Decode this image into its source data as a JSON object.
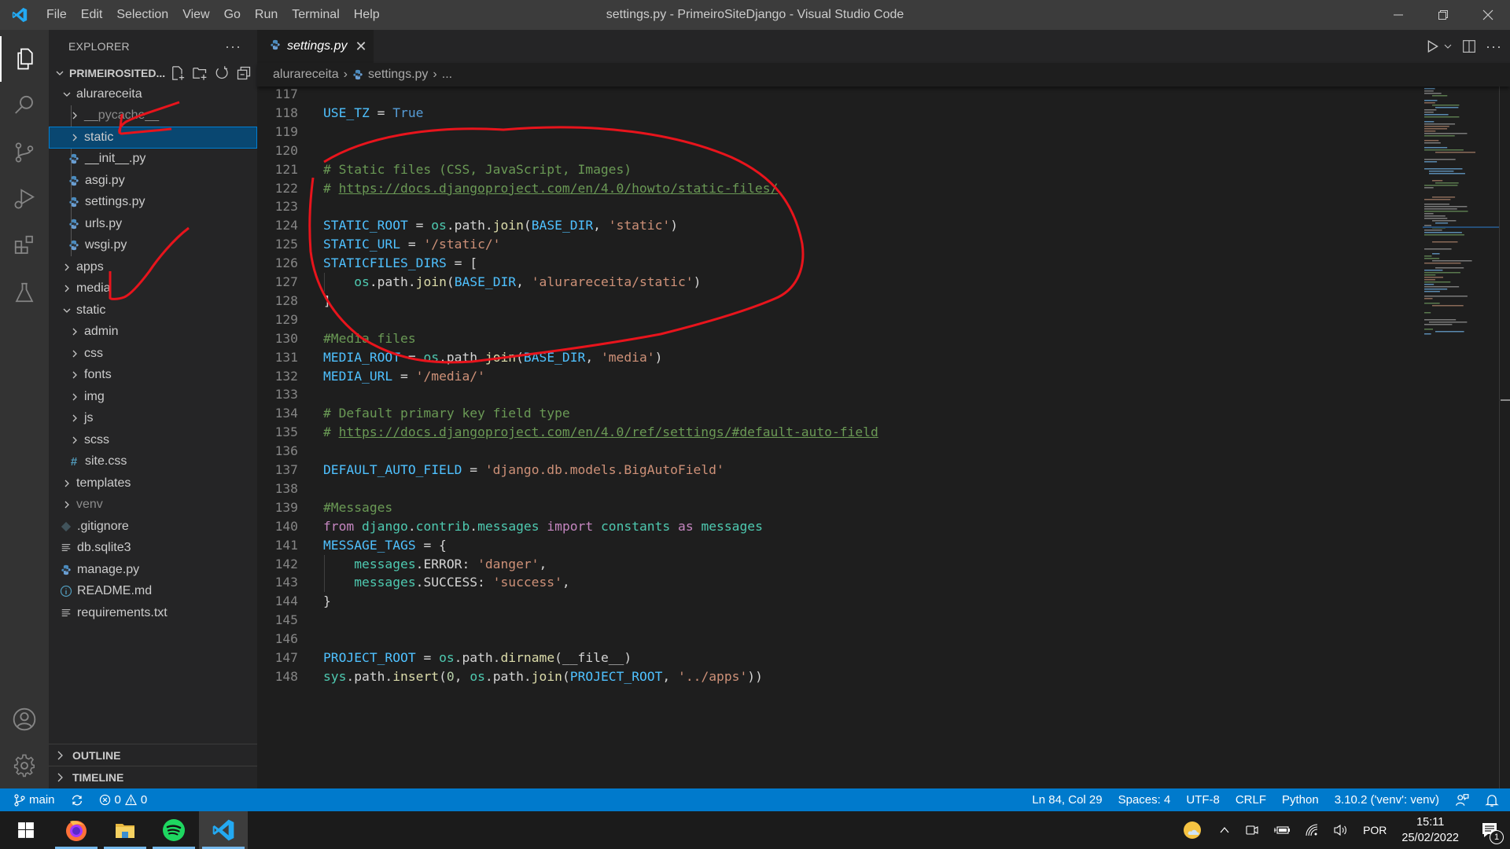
{
  "window": {
    "title": "settings.py - PrimeiroSiteDjango - Visual Studio Code",
    "menu": [
      "File",
      "Edit",
      "Selection",
      "View",
      "Go",
      "Run",
      "Terminal",
      "Help"
    ]
  },
  "sidebar": {
    "header": "EXPLORER",
    "project": "PRIMEIROSITED...",
    "tree": [
      {
        "label": "alurareceita",
        "type": "folder",
        "expanded": true,
        "depth": 1
      },
      {
        "label": "__pycache__",
        "type": "folder",
        "expanded": false,
        "depth": 2,
        "dim": true
      },
      {
        "label": "static",
        "type": "folder",
        "expanded": false,
        "depth": 2,
        "selected": true
      },
      {
        "label": "__init__.py",
        "type": "python",
        "depth": 2
      },
      {
        "label": "asgi.py",
        "type": "python",
        "depth": 2
      },
      {
        "label": "settings.py",
        "type": "python",
        "depth": 2
      },
      {
        "label": "urls.py",
        "type": "python",
        "depth": 2
      },
      {
        "label": "wsgi.py",
        "type": "python",
        "depth": 2
      },
      {
        "label": "apps",
        "type": "folder",
        "expanded": false,
        "depth": 1
      },
      {
        "label": "media",
        "type": "folder",
        "expanded": false,
        "depth": 1
      },
      {
        "label": "static",
        "type": "folder",
        "expanded": true,
        "depth": 1
      },
      {
        "label": "admin",
        "type": "folder",
        "expanded": false,
        "depth": 2
      },
      {
        "label": "css",
        "type": "folder",
        "expanded": false,
        "depth": 2
      },
      {
        "label": "fonts",
        "type": "folder",
        "expanded": false,
        "depth": 2
      },
      {
        "label": "img",
        "type": "folder",
        "expanded": false,
        "depth": 2
      },
      {
        "label": "js",
        "type": "folder",
        "expanded": false,
        "depth": 2
      },
      {
        "label": "scss",
        "type": "folder",
        "expanded": false,
        "depth": 2
      },
      {
        "label": "site.css",
        "type": "css",
        "depth": 2
      },
      {
        "label": "templates",
        "type": "folder",
        "expanded": false,
        "depth": 1
      },
      {
        "label": "venv",
        "type": "folder",
        "expanded": false,
        "depth": 1,
        "dim": true
      },
      {
        "label": ".gitignore",
        "type": "git",
        "depth": 1
      },
      {
        "label": "db.sqlite3",
        "type": "text",
        "depth": 1
      },
      {
        "label": "manage.py",
        "type": "python",
        "depth": 1
      },
      {
        "label": "README.md",
        "type": "info",
        "depth": 1
      },
      {
        "label": "requirements.txt",
        "type": "text",
        "depth": 1
      }
    ],
    "sections": [
      "OUTLINE",
      "TIMELINE"
    ]
  },
  "editor": {
    "tab": {
      "label": "settings.py",
      "icon": "python-icon"
    },
    "breadcrumb": [
      "alurareceita",
      "settings.py",
      "..."
    ],
    "lines": [
      {
        "n": "117",
        "tokens": []
      },
      {
        "n": "118",
        "tokens": [
          [
            "var",
            "USE_TZ"
          ],
          [
            "plain",
            " = "
          ],
          [
            "const",
            "True"
          ]
        ]
      },
      {
        "n": "119",
        "tokens": []
      },
      {
        "n": "120",
        "tokens": []
      },
      {
        "n": "121",
        "tokens": [
          [
            "com",
            "# Static files (CSS, JavaScript, Images)"
          ]
        ]
      },
      {
        "n": "122",
        "tokens": [
          [
            "com",
            "# "
          ],
          [
            "link",
            "https://docs.djangoproject.com/en/4.0/howto/static-files/"
          ]
        ]
      },
      {
        "n": "123",
        "tokens": []
      },
      {
        "n": "124",
        "tokens": [
          [
            "var",
            "STATIC_ROOT"
          ],
          [
            "plain",
            " = "
          ],
          [
            "mod",
            "os"
          ],
          [
            "plain",
            "."
          ],
          [
            "plain",
            "path"
          ],
          [
            "plain",
            "."
          ],
          [
            "fn",
            "join"
          ],
          [
            "plain",
            "("
          ],
          [
            "var",
            "BASE_DIR"
          ],
          [
            "plain",
            ", "
          ],
          [
            "str",
            "'static'"
          ],
          [
            "plain",
            ")"
          ]
        ]
      },
      {
        "n": "125",
        "tokens": [
          [
            "var",
            "STATIC_URL"
          ],
          [
            "plain",
            " = "
          ],
          [
            "str",
            "'/static/'"
          ]
        ]
      },
      {
        "n": "126",
        "tokens": [
          [
            "var",
            "STATICFILES_DIRS"
          ],
          [
            "plain",
            " = ["
          ]
        ]
      },
      {
        "n": "127",
        "tokens": [
          [
            "plain",
            "    "
          ],
          [
            "mod",
            "os"
          ],
          [
            "plain",
            ".path."
          ],
          [
            "fn",
            "join"
          ],
          [
            "plain",
            "("
          ],
          [
            "var",
            "BASE_DIR"
          ],
          [
            "plain",
            ", "
          ],
          [
            "str",
            "'alurareceita/static'"
          ],
          [
            "plain",
            ")"
          ]
        ]
      },
      {
        "n": "128",
        "tokens": [
          [
            "plain",
            "]"
          ]
        ]
      },
      {
        "n": "129",
        "tokens": []
      },
      {
        "n": "130",
        "tokens": [
          [
            "com",
            "#Media files"
          ]
        ]
      },
      {
        "n": "131",
        "tokens": [
          [
            "var",
            "MEDIA_ROOT"
          ],
          [
            "plain",
            " = "
          ],
          [
            "mod",
            "os"
          ],
          [
            "plain",
            ".path."
          ],
          [
            "fn",
            "join"
          ],
          [
            "plain",
            "("
          ],
          [
            "var",
            "BASE_DIR"
          ],
          [
            "plain",
            ", "
          ],
          [
            "str",
            "'media'"
          ],
          [
            "plain",
            ")"
          ]
        ]
      },
      {
        "n": "132",
        "tokens": [
          [
            "var",
            "MEDIA_URL"
          ],
          [
            "plain",
            " = "
          ],
          [
            "str",
            "'/media/'"
          ]
        ]
      },
      {
        "n": "133",
        "tokens": []
      },
      {
        "n": "134",
        "tokens": [
          [
            "com",
            "# Default primary key field type"
          ]
        ]
      },
      {
        "n": "135",
        "tokens": [
          [
            "com",
            "# "
          ],
          [
            "link",
            "https://docs.djangoproject.com/en/4.0/ref/settings/#default-auto-field"
          ]
        ]
      },
      {
        "n": "136",
        "tokens": []
      },
      {
        "n": "137",
        "tokens": [
          [
            "var",
            "DEFAULT_AUTO_FIELD"
          ],
          [
            "plain",
            " = "
          ],
          [
            "str",
            "'django.db.models.BigAutoField'"
          ]
        ]
      },
      {
        "n": "138",
        "tokens": []
      },
      {
        "n": "139",
        "tokens": [
          [
            "com",
            "#Messages"
          ]
        ]
      },
      {
        "n": "140",
        "tokens": [
          [
            "kw",
            "from"
          ],
          [
            "plain",
            " "
          ],
          [
            "mod",
            "django"
          ],
          [
            "plain",
            "."
          ],
          [
            "mod",
            "contrib"
          ],
          [
            "plain",
            "."
          ],
          [
            "mod",
            "messages"
          ],
          [
            "plain",
            " "
          ],
          [
            "kw",
            "import"
          ],
          [
            "plain",
            " "
          ],
          [
            "mod",
            "constants"
          ],
          [
            "plain",
            " "
          ],
          [
            "kw",
            "as"
          ],
          [
            "plain",
            " "
          ],
          [
            "mod",
            "messages"
          ]
        ]
      },
      {
        "n": "141",
        "tokens": [
          [
            "var",
            "MESSAGE_TAGS"
          ],
          [
            "plain",
            " = {"
          ]
        ]
      },
      {
        "n": "142",
        "tokens": [
          [
            "plain",
            "    "
          ],
          [
            "mod",
            "messages"
          ],
          [
            "plain",
            ".ERROR: "
          ],
          [
            "str",
            "'danger'"
          ],
          [
            "plain",
            ","
          ]
        ]
      },
      {
        "n": "143",
        "tokens": [
          [
            "plain",
            "    "
          ],
          [
            "mod",
            "messages"
          ],
          [
            "plain",
            ".SUCCESS: "
          ],
          [
            "str",
            "'success'"
          ],
          [
            "plain",
            ","
          ]
        ]
      },
      {
        "n": "144",
        "tokens": [
          [
            "plain",
            "}"
          ]
        ]
      },
      {
        "n": "145",
        "tokens": []
      },
      {
        "n": "146",
        "tokens": []
      },
      {
        "n": "147",
        "tokens": [
          [
            "var",
            "PROJECT_ROOT"
          ],
          [
            "plain",
            " = "
          ],
          [
            "mod",
            "os"
          ],
          [
            "plain",
            ".path."
          ],
          [
            "fn",
            "dirname"
          ],
          [
            "plain",
            "(__file__)"
          ]
        ]
      },
      {
        "n": "148",
        "tokens": [
          [
            "mod",
            "sys"
          ],
          [
            "plain",
            ".path."
          ],
          [
            "fn",
            "insert"
          ],
          [
            "plain",
            "("
          ],
          [
            "num",
            "0"
          ],
          [
            "plain",
            ", "
          ],
          [
            "mod",
            "os"
          ],
          [
            "plain",
            ".path."
          ],
          [
            "fn",
            "join"
          ],
          [
            "plain",
            "("
          ],
          [
            "var",
            "PROJECT_ROOT"
          ],
          [
            "plain",
            ", "
          ],
          [
            "str",
            "'../apps'"
          ],
          [
            "plain",
            "))"
          ]
        ]
      }
    ]
  },
  "statusbar": {
    "branch": "main",
    "errors": "0",
    "warnings": "0",
    "position": "Ln 84, Col 29",
    "spaces": "Spaces: 4",
    "encoding": "UTF-8",
    "eol": "CRLF",
    "language": "Python",
    "interpreter": "3.10.2 ('venv': venv)"
  },
  "taskbar": {
    "apps": [
      "Firefox",
      "File Explorer",
      "Spotify",
      "Visual Studio Code"
    ],
    "language": "POR",
    "time": "15:11",
    "date": "25/02/2022",
    "notifications": "1"
  },
  "colors": {
    "accent": "#007acc",
    "annotation": "#e8141c"
  }
}
